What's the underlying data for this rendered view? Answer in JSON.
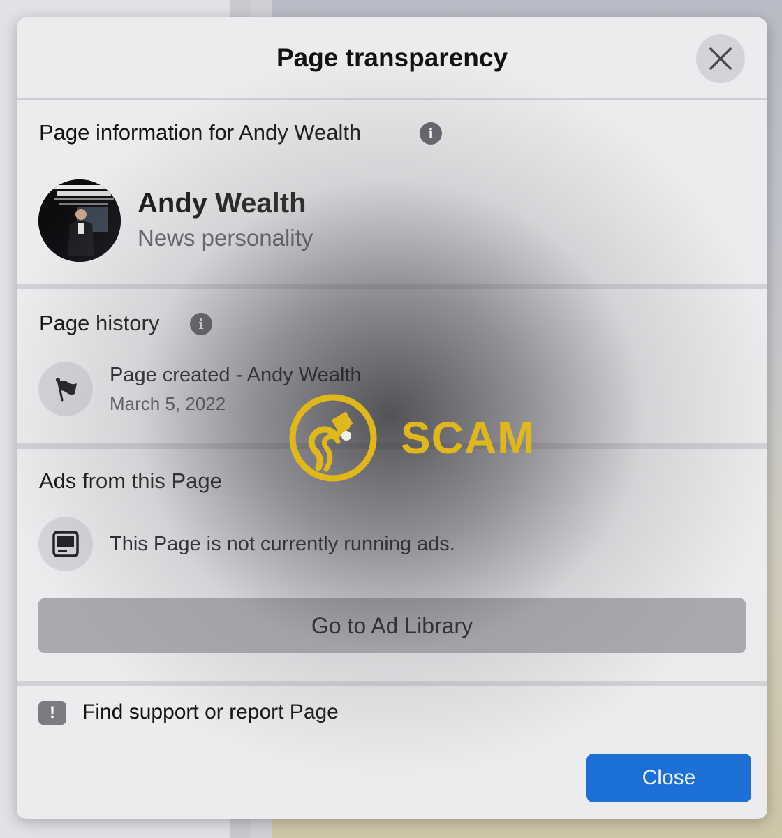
{
  "modal": {
    "title": "Page transparency"
  },
  "page_info": {
    "heading": "Page information for Andy Wealth",
    "name": "Andy Wealth",
    "category": "News personality"
  },
  "history": {
    "heading": "Page history",
    "event": "Page created - Andy Wealth",
    "date": "March 5, 2022"
  },
  "ads": {
    "heading": "Ads from this Page",
    "status": "This Page is not currently running ads.",
    "library_button": "Go to Ad Library"
  },
  "support": {
    "label": "Find support or report Page"
  },
  "footer": {
    "close_label": "Close"
  },
  "watermark": {
    "text": "SCAM",
    "color": "#e0b81c"
  },
  "colors": {
    "primary_button": "#1d6fd8",
    "secondary_button": "#a9a9ae"
  }
}
